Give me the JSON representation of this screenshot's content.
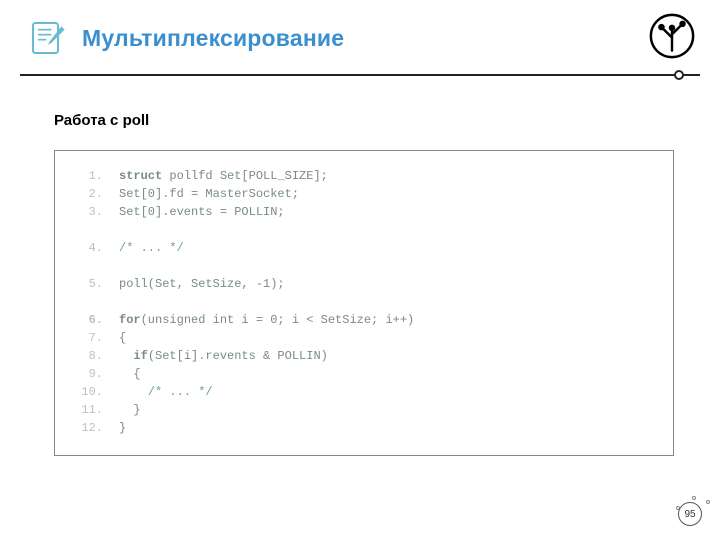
{
  "header": {
    "title": "Мультиплексирование",
    "editIcon": "edit-icon",
    "treeIcon": "tree-icon"
  },
  "subtitle": "Работа с poll",
  "code": {
    "lines": [
      {
        "n": "1.",
        "bold": false,
        "segments": [
          {
            "t": "struct",
            "k": "kw"
          },
          {
            "t": " pollfd Set[POLL_SIZE];"
          }
        ]
      },
      {
        "n": "2.",
        "bold": false,
        "segments": [
          {
            "t": "Set[0].fd = MasterSocket;"
          }
        ]
      },
      {
        "n": "3.",
        "bold": false,
        "segments": [
          {
            "t": "Set[0].events = POLLIN;"
          }
        ]
      },
      {
        "blank": true
      },
      {
        "n": "4.",
        "bold": false,
        "segments": [
          {
            "t": "/* ... */",
            "k": "cm"
          }
        ]
      },
      {
        "blank": true
      },
      {
        "n": "5.",
        "bold": false,
        "segments": [
          {
            "t": "poll(Set, SetSize, -1);"
          }
        ]
      },
      {
        "blank": true
      },
      {
        "n": "6.",
        "bold": true,
        "segments": [
          {
            "t": "for",
            "k": "kw"
          },
          {
            "t": "(unsigned int i = 0; i < SetSize; i++)"
          }
        ]
      },
      {
        "n": "7.",
        "bold": false,
        "segments": [
          {
            "t": "{"
          }
        ]
      },
      {
        "n": "8.",
        "bold": false,
        "segments": [
          {
            "t": "  "
          },
          {
            "t": "if",
            "k": "kw"
          },
          {
            "t": "(Set[i].revents & POLLIN)"
          }
        ]
      },
      {
        "n": "9.",
        "bold": false,
        "segments": [
          {
            "t": "  {"
          }
        ]
      },
      {
        "n": "10.",
        "bold": false,
        "segments": [
          {
            "t": "    "
          },
          {
            "t": "/* ... */",
            "k": "cm"
          }
        ]
      },
      {
        "n": "11.",
        "bold": false,
        "segments": [
          {
            "t": "  }"
          }
        ]
      },
      {
        "n": "12.",
        "bold": false,
        "segments": [
          {
            "t": "}"
          }
        ]
      }
    ]
  },
  "pageNumber": "95"
}
